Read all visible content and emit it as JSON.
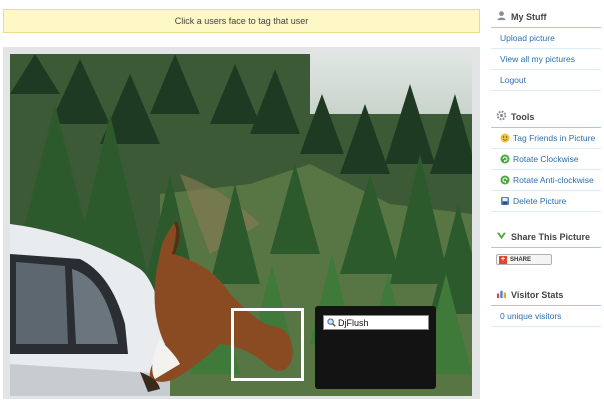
{
  "notice": {
    "text": "Click a users face to tag that user"
  },
  "tagger": {
    "name_value": "DjFlush"
  },
  "sidebar": {
    "my_stuff": {
      "title": "My Stuff",
      "icon": "user-icon",
      "links": [
        "Upload picture",
        "View all my pictures",
        "Logout"
      ]
    },
    "tools": {
      "title": "Tools",
      "icon": "gear-icon",
      "links": [
        {
          "label": "Tag Friends in Picture",
          "icon": "tag-friends-icon"
        },
        {
          "label": "Rotate Clockwise",
          "icon": "rotate-clockwise-icon"
        },
        {
          "label": "Rotate Anti-clockwise",
          "icon": "rotate-anticlockwise-icon"
        },
        {
          "label": "Delete Picture",
          "icon": "delete-icon"
        }
      ]
    },
    "share": {
      "title": "Share This Picture",
      "icon": "share-icon",
      "button": "SHARE"
    },
    "stats": {
      "title": "Visitor Stats",
      "icon": "stats-icon",
      "link": "0 unique visitors"
    }
  },
  "colors": {
    "link": "#2a6fb0",
    "notice_bg": "#fdf8c6",
    "divider": "#9fd0e2"
  }
}
